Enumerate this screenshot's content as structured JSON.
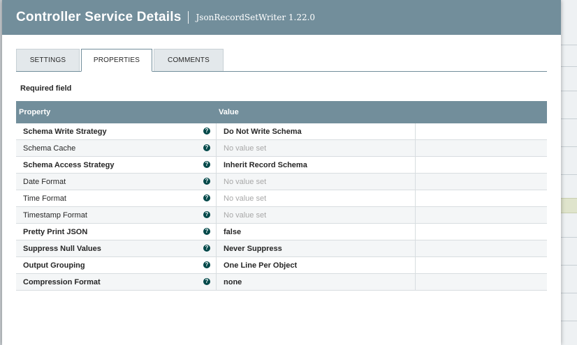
{
  "dialog": {
    "title": "Controller Service Details",
    "subtitle": "JsonRecordSetWriter 1.22.0"
  },
  "tabs": [
    {
      "label": "SETTINGS",
      "active": false
    },
    {
      "label": "PROPERTIES",
      "active": true
    },
    {
      "label": "COMMENTS",
      "active": false
    }
  ],
  "required_label": "Required field",
  "table": {
    "headers": {
      "property": "Property",
      "value": "Value"
    },
    "help_glyph": "?",
    "rows": [
      {
        "name": "Schema Write Strategy",
        "required": true,
        "value": "Do Not Write Schema",
        "is_set": true
      },
      {
        "name": "Schema Cache",
        "required": false,
        "value": "No value set",
        "is_set": false
      },
      {
        "name": "Schema Access Strategy",
        "required": true,
        "value": "Inherit Record Schema",
        "is_set": true
      },
      {
        "name": "Date Format",
        "required": false,
        "value": "No value set",
        "is_set": false
      },
      {
        "name": "Time Format",
        "required": false,
        "value": "No value set",
        "is_set": false
      },
      {
        "name": "Timestamp Format",
        "required": false,
        "value": "No value set",
        "is_set": false
      },
      {
        "name": "Pretty Print JSON",
        "required": true,
        "value": "false",
        "is_set": true
      },
      {
        "name": "Suppress Null Values",
        "required": true,
        "value": "Never Suppress",
        "is_set": true
      },
      {
        "name": "Output Grouping",
        "required": true,
        "value": "One Line Per Object",
        "is_set": true
      },
      {
        "name": "Compression Format",
        "required": true,
        "value": "none",
        "is_set": true
      }
    ]
  },
  "colors": {
    "header": "#728e9b",
    "help_icon": "#004849",
    "unset_text": "#a8a8a8"
  }
}
